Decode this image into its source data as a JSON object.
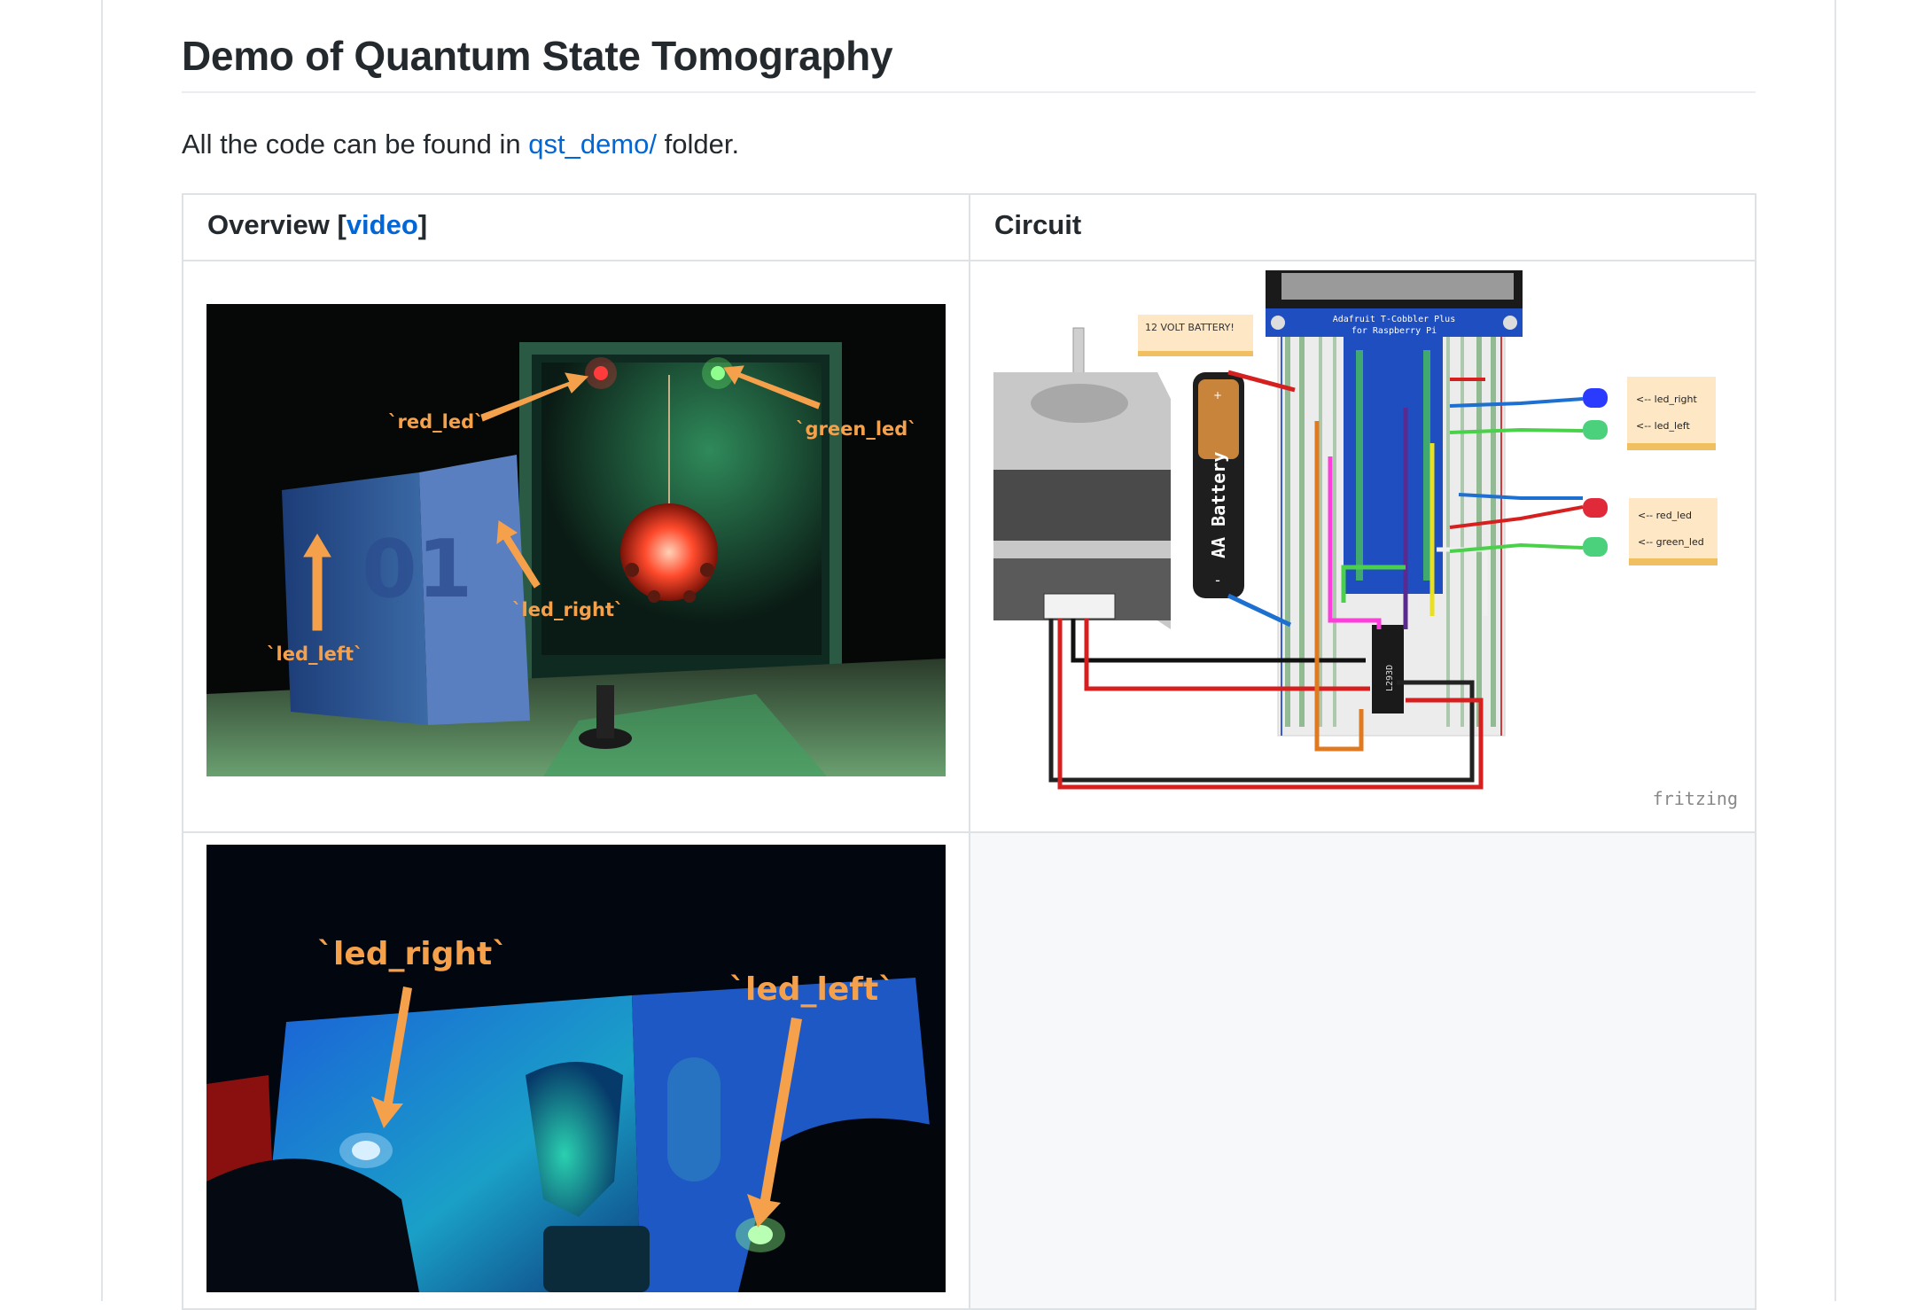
{
  "page": {
    "title": "Demo of Quantum State Tomography",
    "intro_prefix": "All the code can be found in ",
    "intro_link": "qst_demo/",
    "intro_suffix": " folder."
  },
  "table": {
    "col1_header_prefix": "Overview [",
    "col1_header_link": "video",
    "col1_header_suffix": "]",
    "col2_header": "Circuit"
  },
  "photo1": {
    "labels": {
      "red_led": "`red_led`",
      "green_led": "`green_led`",
      "led_left": "`led_left`",
      "led_right": "`led_right`"
    }
  },
  "photo2": {
    "labels": {
      "led_right": "`led_right`",
      "led_left": "`led_left`"
    }
  },
  "circuit": {
    "battery_note": "12 VOLT BATTERY!",
    "cobbler_title_1": "Adafruit T-Cobbler Plus",
    "cobbler_title_2": "for Raspberry Pi",
    "aa_battery": "AA Battery",
    "plus_sign": "+",
    "minus_sign": "-",
    "ic_label": "L293D",
    "note_led_right": "<-- led_right",
    "note_led_left": "<-- led_left",
    "note_red_led": "<-- red_led",
    "note_green_led": "<-- green_led",
    "fritzing": "fritzing"
  },
  "colors": {
    "link": "#0366d6",
    "border": "#dfe2e5",
    "annotation_orange": "#f5a04a",
    "note_bg": "#fde7c5"
  }
}
